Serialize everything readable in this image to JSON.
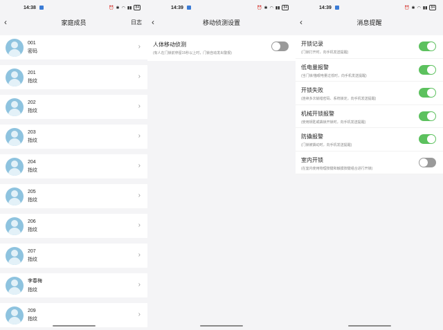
{
  "screens": {
    "members": {
      "status": {
        "time": "14:38",
        "battery": "84"
      },
      "title": "家庭成员",
      "right_action": "日志",
      "items": [
        {
          "name": "001",
          "type": "密码"
        },
        {
          "name": "201",
          "type": "指纹"
        },
        {
          "name": "202",
          "type": "指纹"
        },
        {
          "name": "203",
          "type": "指纹"
        },
        {
          "name": "204",
          "type": "指纹"
        },
        {
          "name": "205",
          "type": "指纹"
        },
        {
          "name": "206",
          "type": "指纹"
        },
        {
          "name": "207",
          "type": "指纹"
        },
        {
          "name": "李春梅",
          "type": "指纹"
        },
        {
          "name": "209",
          "type": "指纹"
        }
      ]
    },
    "motion": {
      "status": {
        "time": "14:39",
        "battery": "84"
      },
      "title": "移动侦测设置",
      "setting": {
        "title": "人体移动侦测",
        "desc": "(有人在门锁前停留15秒以上时，门锁自动发出警报)",
        "on": false
      }
    },
    "notifications": {
      "status": {
        "time": "14:39",
        "battery": "84"
      },
      "title": "消息提醒",
      "items": [
        {
          "title": "开锁记录",
          "desc": "(门锁打开时，向手机发送提醒)",
          "on": true
        },
        {
          "title": "低电量报警",
          "desc": "(当门锁/猫眼电量过低时，向手机发送提醒)",
          "on": true
        },
        {
          "title": "开锁失败",
          "desc": "(连续多次输错密码、系统锁定，向手机发送提醒)",
          "on": true
        },
        {
          "title": "机械开锁报警",
          "desc": "(使用钥匙或撬锁开锁时，向手机发送提醒)",
          "on": true
        },
        {
          "title": "防撬报警",
          "desc": "(门锁被撬动时，向手机发送提醒)",
          "on": true
        },
        {
          "title": "室内开锁",
          "desc": "(在室内使用物理按键和触摸按键组合进行开锁)",
          "on": false
        }
      ]
    }
  },
  "colors": {
    "toggle_on": "#5cc15e",
    "toggle_off": "#9a9a9a",
    "avatar": "#8ec3df",
    "background": "#f4f4f6"
  },
  "icons": {
    "back": "chevron-left-icon",
    "row": "chevron-right-icon",
    "avatar": "user-avatar-icon"
  }
}
